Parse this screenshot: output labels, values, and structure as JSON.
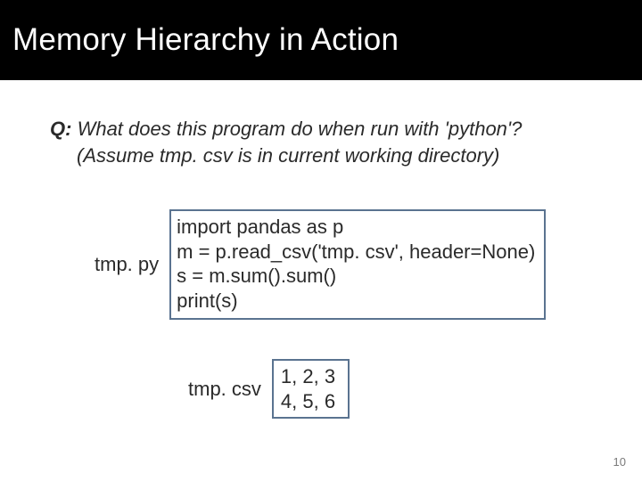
{
  "title": "Memory Hierarchy in Action",
  "question": {
    "label": "Q:",
    "line1_rest": " What does this program do when run with 'python'?",
    "line2": "(Assume tmp. csv is in current working directory)"
  },
  "tmp_py": {
    "label": "tmp. py",
    "lines": [
      "import pandas as p",
      "m = p.read_csv('tmp. csv', header=None)",
      "s = m.sum().sum()",
      "print(s)"
    ]
  },
  "tmp_csv": {
    "label": "tmp. csv",
    "lines": [
      "1, 2, 3",
      "4, 5, 6"
    ]
  },
  "page_number": "10"
}
